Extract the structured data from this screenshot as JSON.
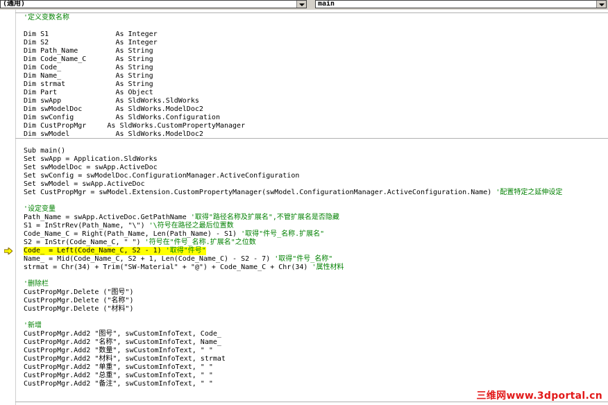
{
  "toolbar": {
    "object_combo": "(通用)",
    "procedure_combo": "main"
  },
  "code_lines": [
    "'定义变数名称",
    "Dim S1                As Integer",
    "Dim S2                As Integer",
    "Dim Path_Name         As String",
    "Dim Code_Name_C       As String",
    "Dim Code_             As String",
    "Dim Name_             As String",
    "Dim strmat            As String",
    "Dim Part              As Object",
    "Dim swApp             As SldWorks.SldWorks",
    "Dim swModelDoc        As SldWorks.ModelDoc2",
    "Dim swConfig          As SldWorks.Configuration",
    "Dim CustPropMgr     As SldWorks.CustomPropertyManager",
    "Dim swModel           As SldWorks.ModelDoc2",
    "Sub main()",
    "Set swApp = Application.SldWorks",
    "Set swModelDoc = swApp.ActiveDoc",
    "Set swConfig = swModelDoc.ConfigurationManager.ActiveConfiguration",
    "Set swModel = swApp.ActiveDoc",
    "Set CustPropMgr = swModel.Extension.CustomPropertyManager(swModel.ConfigurationManager.ActiveConfiguration.Name) ",
    "'配置特定之延伸设定",
    "'设定变量",
    "Path_Name = swApp.ActiveDoc.GetPathName ",
    "'取得\"路径名称及扩展名\",不管扩展名是否隐藏",
    "S1 = InStrRev(Path_Name, \"\\\") ",
    "'\\符号在路径之最后位置数",
    "Code_Name_C = Right(Path_Name, Len(Path_Name) - S1) ",
    "'取得\"件号_名称.扩展名\"",
    "S2 = InStr(Code_Name_C, \" \") ",
    "'符号在\"件号_名称.扩展名\"之位数",
    "Code_ = Left(Code_Name_C, S2 - 1) ",
    "'取得\"件号\"",
    "Name_ = Mid(Code_Name_C, S2 + 1, Len(Code_Name_C) - S2 - 7) ",
    "'取得\"件号_名称\"",
    "strmat = Chr(34) + Trim(\"SW-Material\" + \"@\") + Code_Name_C + Chr(34) ",
    "'属性材料",
    "'删除栏",
    "CustPropMgr.Delete (\"图号\")",
    "CustPropMgr.Delete (\"名称\")",
    "CustPropMgr.Delete (\"材料\")",
    "'新增",
    "CustPropMgr.Add2 \"图号\", swCustomInfoText, Code_",
    "CustPropMgr.Add2 \"名称\", swCustomInfoText, Name_",
    "CustPropMgr.Add2 \"数量\", swCustomInfoText, \" \"",
    "CustPropMgr.Add2 \"材料\", swCustomInfoText, strmat",
    "CustPropMgr.Add2 \"单重\", swCustomInfoText, \" \"",
    "CustPropMgr.Add2 \"总重\", swCustomInfoText, \" \"",
    "CustPropMgr.Add2 \"备注\", swCustomInfoText, \" \""
  ],
  "watermark": "三维网www.3dportal.cn",
  "colors": {
    "comment": "#008000",
    "highlight": "#ffff00",
    "arrow": "#ffff00",
    "watermark": "#e21a1a"
  },
  "icons": {
    "execution_pointer": "arrow-right-icon"
  }
}
